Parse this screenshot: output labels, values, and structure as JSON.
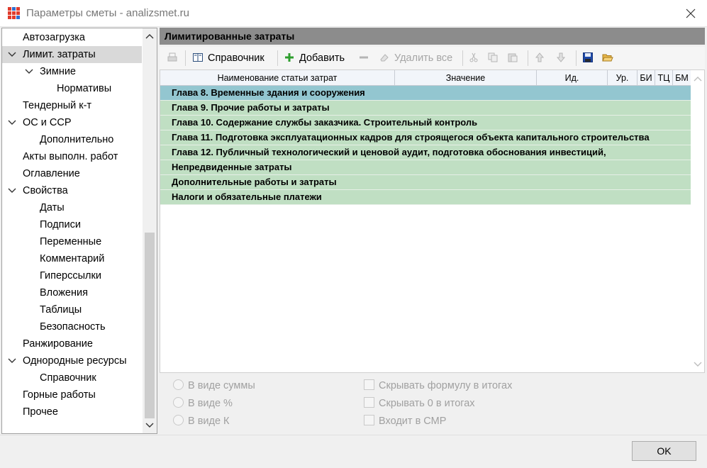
{
  "window": {
    "title": "Параметры сметы - analizsmet.ru",
    "icons": {
      "app": "app-grid-icon",
      "close": "close-icon"
    }
  },
  "sidebar": {
    "items": [
      {
        "label": "Автозагрузка"
      },
      {
        "label": "Лимит. затраты",
        "expanded": true,
        "selected": true
      },
      {
        "label": "Зимние",
        "expanded": true
      },
      {
        "label": "Нормативы"
      },
      {
        "label": "Тендерный к-т"
      },
      {
        "label": "ОС и ССР",
        "expanded": true
      },
      {
        "label": "Дополнительно"
      },
      {
        "label": "Акты выполн. работ"
      },
      {
        "label": "Оглавление"
      },
      {
        "label": "Свойства",
        "expanded": true
      },
      {
        "label": "Даты"
      },
      {
        "label": "Подписи"
      },
      {
        "label": "Переменные"
      },
      {
        "label": "Комментарий"
      },
      {
        "label": "Гиперссылки"
      },
      {
        "label": "Вложения"
      },
      {
        "label": "Таблицы"
      },
      {
        "label": "Безопасность"
      },
      {
        "label": "Ранжирование"
      },
      {
        "label": "Однородные ресурсы",
        "expanded": true
      },
      {
        "label": "Справочник"
      },
      {
        "label": "Горные работы"
      },
      {
        "label": "Прочее"
      }
    ]
  },
  "panel": {
    "title": "Лимитированные затраты",
    "toolbar": {
      "reference_label": "Справочник",
      "add_label": "Добавить",
      "delete_all_label": "Удалить все"
    },
    "columns": [
      "Наименование статьи затрат",
      "Значение",
      "Ид.",
      "Ур.",
      "БИ",
      "ТЦ",
      "БМ"
    ],
    "rows": [
      {
        "name": "Глава 8. Временные здания и сооружения",
        "selected": true
      },
      {
        "name": "Глава 9. Прочие работы и затраты"
      },
      {
        "name": "Глава 10. Содержание службы заказчика. Строительный контроль"
      },
      {
        "name": "Глава 11. Подготовка эксплуатационных кадров для строящегося объекта капитального строительства"
      },
      {
        "name": "Глава 12. Публичный технологический и ценовой аудит, подготовка обоснования инвестиций,"
      },
      {
        "name": "Непредвиденные затраты"
      },
      {
        "name": "Дополнительные работы и затраты"
      },
      {
        "name": "Налоги и обязательные платежи"
      }
    ],
    "options": {
      "radio_sum": "В виде суммы",
      "radio_percent": "В виде %",
      "radio_k": "В виде К",
      "check_hide_formula": "Скрывать формулу в итогах",
      "check_hide_zero": "Скрывать 0 в итогах",
      "check_in_smr": "Входит в СМР"
    }
  },
  "footer": {
    "ok_label": "OK"
  },
  "colors": {
    "row_green": "#c0dfc3",
    "row_selected": "#93c6d0",
    "header_gray": "#8c8c8c"
  }
}
